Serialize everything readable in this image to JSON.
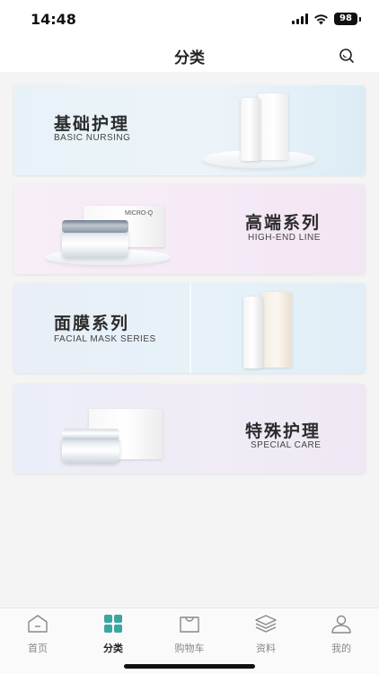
{
  "status_bar": {
    "time": "14:48",
    "battery": "98"
  },
  "header": {
    "title": "分类"
  },
  "categories": [
    {
      "title": "基础护理",
      "subtitle": "BASIC NURSING"
    },
    {
      "title": "高端系列",
      "subtitle": "HIGH-END LINE"
    },
    {
      "title": "面膜系列",
      "subtitle": "FACIAL MASK SERIES"
    },
    {
      "title": "特殊护理",
      "subtitle": "SPECIAL CARE"
    }
  ],
  "product_text": {
    "micro": "MICRO-Q"
  },
  "tabs": [
    {
      "label": "首页",
      "icon": "home-icon"
    },
    {
      "label": "分类",
      "icon": "grid-icon"
    },
    {
      "label": "购物车",
      "icon": "bag-icon"
    },
    {
      "label": "资料",
      "icon": "layers-icon"
    },
    {
      "label": "我的",
      "icon": "user-icon"
    }
  ],
  "colors": {
    "active_tab": "#3aa6a1",
    "inactive_tab": "#888888"
  }
}
